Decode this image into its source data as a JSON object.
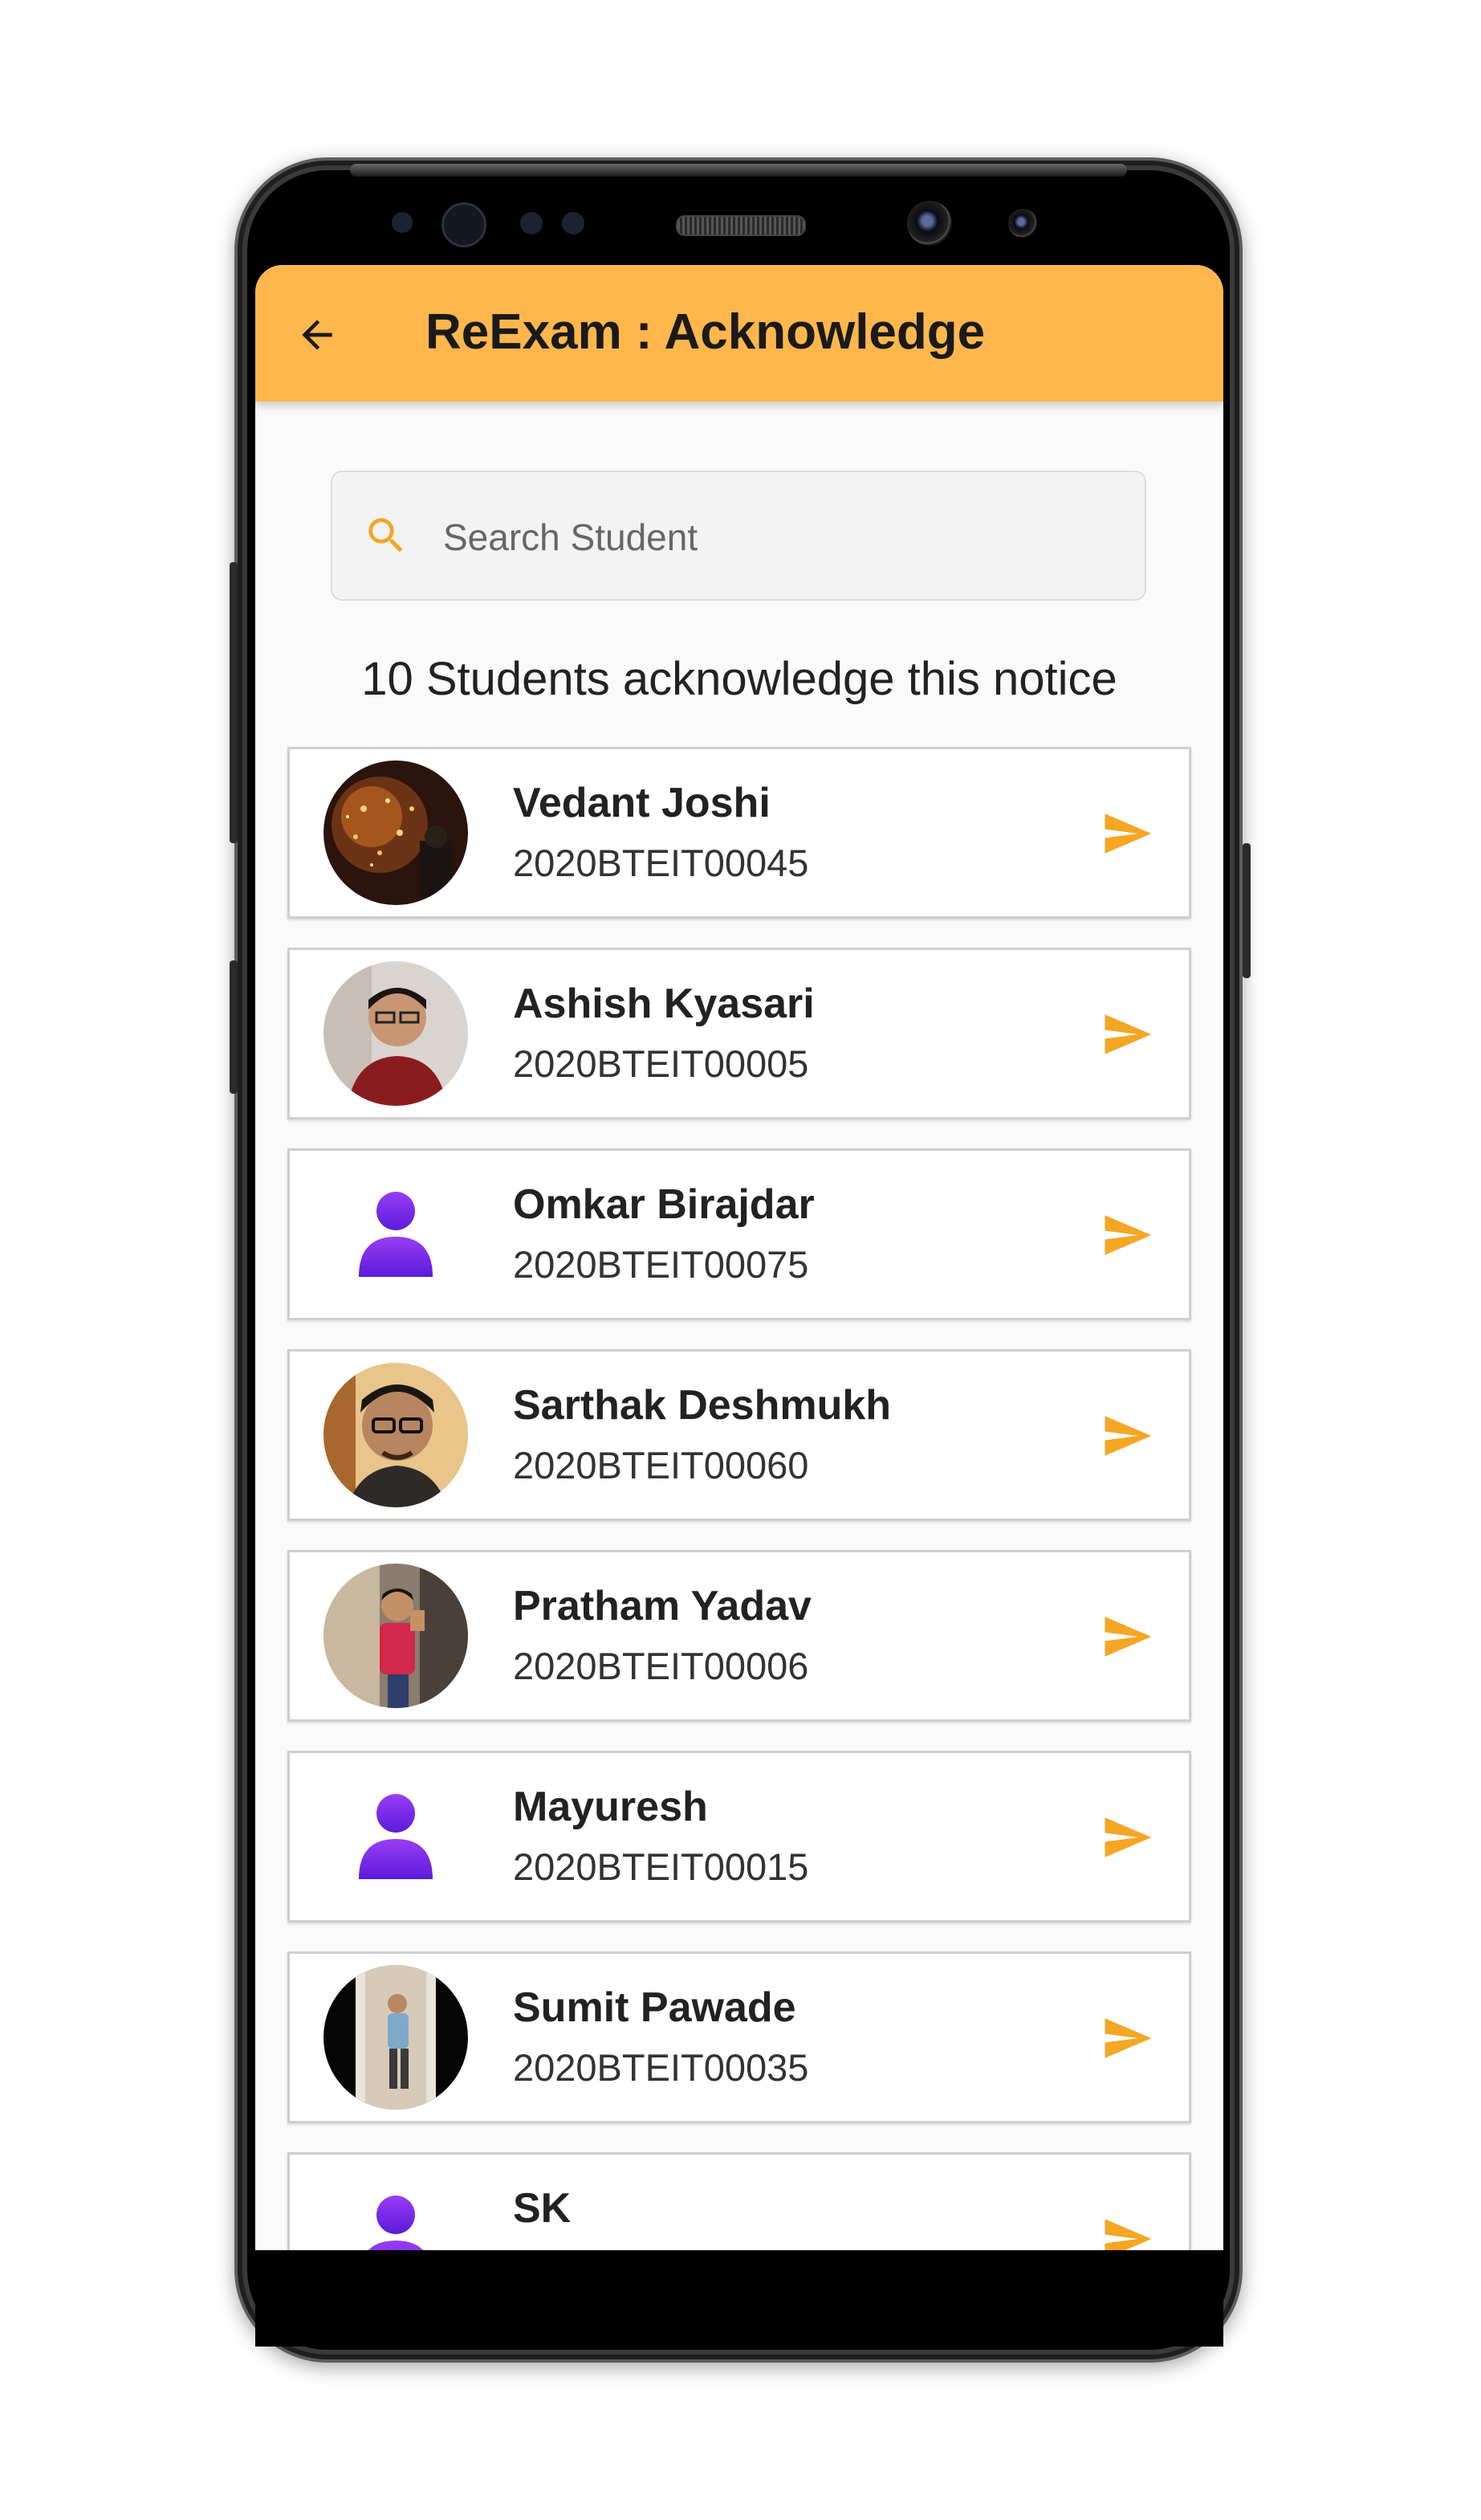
{
  "appbar": {
    "title": "ReExam : Acknowledge"
  },
  "search": {
    "placeholder": "Search Student",
    "value": ""
  },
  "summary": {
    "text": "10 Students acknowledge this notice"
  },
  "colors": {
    "accent": "#ffb74d",
    "icon": "#f5a623",
    "avatar_default": "#7b2cf0"
  },
  "students": [
    {
      "name": "Vedant Joshi",
      "roll": "2020BTEIT00045",
      "avatar": "photo-lights"
    },
    {
      "name": "Ashish Kyasari",
      "roll": "2020BTEIT00005",
      "avatar": "photo-person"
    },
    {
      "name": "Omkar Birajdar",
      "roll": "2020BTEIT00075",
      "avatar": "default-user-icon"
    },
    {
      "name": "Sarthak Deshmukh",
      "roll": "2020BTEIT00060",
      "avatar": "photo-person"
    },
    {
      "name": "Pratham Yadav",
      "roll": "2020BTEIT00006",
      "avatar": "photo-person"
    },
    {
      "name": "Mayuresh",
      "roll": "2020BTEIT00015",
      "avatar": "default-user-icon"
    },
    {
      "name": "Sumit Pawade",
      "roll": "2020BTEIT00035",
      "avatar": "photo-person"
    },
    {
      "name": "SK",
      "roll": "",
      "avatar": "default-user-icon"
    }
  ]
}
